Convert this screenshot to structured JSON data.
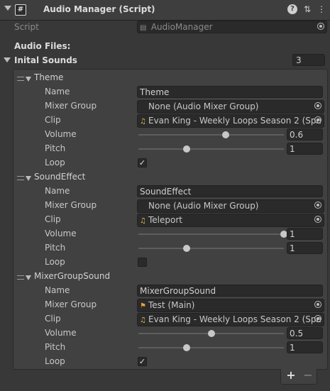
{
  "header": {
    "icon": "script-icon",
    "icon_glyph": "#",
    "title": "Audio Manager (Script)",
    "help_glyph": "?",
    "preset_glyph": "⇅",
    "menu_glyph": "⋮"
  },
  "script": {
    "label": "Script",
    "value": "AudioManager",
    "icon_glyph": "▤"
  },
  "section_title": "Audio Files:",
  "list": {
    "label": "Inital Sounds",
    "count": "3",
    "add_glyph": "+",
    "remove_glyph": "−",
    "elements": [
      {
        "title": "Theme",
        "name_label": "Name",
        "name": "Theme",
        "mixer_label": "Mixer Group",
        "mixer": "None (Audio Mixer Group)",
        "mixer_icon": "",
        "clip_label": "Clip",
        "clip": "Evan King - Weekly Loops Season 2 (Spe",
        "clip_icon": "♫",
        "volume_label": "Volume",
        "volume": "0.6",
        "volume_fraction": 0.6,
        "pitch_label": "Pitch",
        "pitch": "1",
        "pitch_fraction": 0.33,
        "loop_label": "Loop",
        "loop": "✓"
      },
      {
        "title": "SoundEffect",
        "name_label": "Name",
        "name": "SoundEffect",
        "mixer_label": "Mixer Group",
        "mixer": "None (Audio Mixer Group)",
        "mixer_icon": "",
        "clip_label": "Clip",
        "clip": "Teleport",
        "clip_icon": "♫",
        "volume_label": "Volume",
        "volume": "1",
        "volume_fraction": 1.0,
        "pitch_label": "Pitch",
        "pitch": "1",
        "pitch_fraction": 0.33,
        "loop_label": "Loop",
        "loop": ""
      },
      {
        "title": "MixerGroupSound",
        "name_label": "Name",
        "name": "MixerGroupSound",
        "mixer_label": "Mixer Group",
        "mixer": "Test (Main)",
        "mixer_icon": "⚑",
        "clip_label": "Clip",
        "clip": "Evan King - Weekly Loops Season 2 (Spe",
        "clip_icon": "♫",
        "volume_label": "Volume",
        "volume": "0.5",
        "volume_fraction": 0.5,
        "pitch_label": "Pitch",
        "pitch": "1",
        "pitch_fraction": 0.33,
        "loop_label": "Loop",
        "loop": "✓"
      }
    ]
  }
}
